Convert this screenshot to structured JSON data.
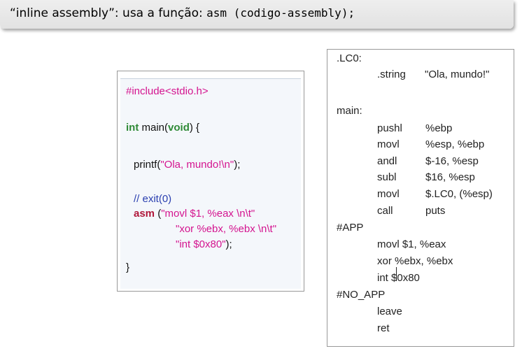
{
  "header": {
    "text_a": "“inline assembly”: usa a função: ",
    "text_b": "asm (codigo-assembly);"
  },
  "c_code": {
    "include": "#include<stdio.h>",
    "int_kw": "int",
    "main_a": " main(",
    "void_kw": "void",
    "main_b": ") {",
    "printf_a": "printf(",
    "printf_str": "\"Ola, mundo!\\n\"",
    "printf_b": ");",
    "comment": "// exit(0)",
    "asm_kw": "asm",
    "asm_a": " (",
    "asm_str1": "\"movl $1, %eax \\n\\t\"",
    "asm_str2": "\"xor %ebx, %ebx \\n\\t\"",
    "asm_str3": "\"int $0x80\"",
    "asm_end": ");",
    "close": "}"
  },
  "asm_listing": {
    "lc0": ".LC0:",
    "string_dir": ".string",
    "string_val": "\"Ola, mundo!\"",
    "main_label": "main:",
    "rows": [
      {
        "op": "pushl",
        "args": "%ebp"
      },
      {
        "op": "movl",
        "args": "%esp, %ebp"
      },
      {
        "op": "andl",
        "args": "$-16, %esp"
      },
      {
        "op": "subl",
        "args": "$16, %esp"
      },
      {
        "op": "movl",
        "args": "$.LC0, (%esp)"
      },
      {
        "op": "call",
        "args": "puts"
      }
    ],
    "app": "#APP",
    "inline": [
      "movl $1, %eax",
      "xor %ebx, %ebx",
      "int $0x80"
    ],
    "no_app": "#NO_APP",
    "tail": [
      "leave",
      "ret"
    ]
  }
}
